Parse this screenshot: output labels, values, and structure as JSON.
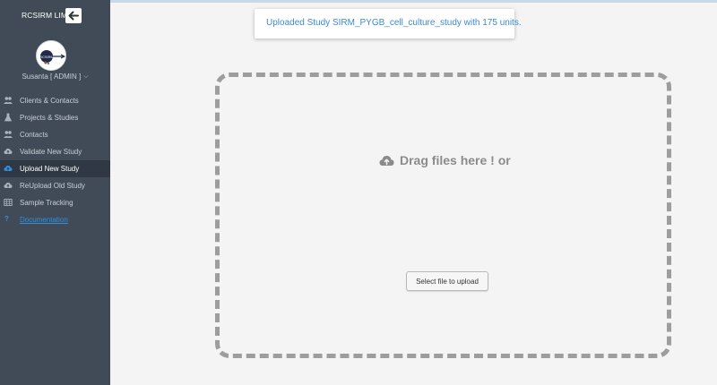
{
  "app": {
    "brand": "RCSIRM LIMS",
    "user_label": "Susanta [ ADMIN ]"
  },
  "sidebar": {
    "items": [
      {
        "label": "Clients & Contacts",
        "icon": "users-icon"
      },
      {
        "label": "Projects & Studies",
        "icon": "flask-icon"
      },
      {
        "label": "Contacts",
        "icon": "users-icon"
      },
      {
        "label": "Validate New Study",
        "icon": "cloud-upload-icon"
      },
      {
        "label": "Upload New Study",
        "icon": "cloud-upload-icon",
        "active": true
      },
      {
        "label": "ReUpload Old Study",
        "icon": "cloud-upload-icon"
      },
      {
        "label": "Sample Tracking",
        "icon": "table-icon"
      },
      {
        "label": "Documentation",
        "icon": "question-icon",
        "link": true
      }
    ]
  },
  "toast": {
    "message": "Uploaded Study SIRM_PYGB_cell_culture_study with 175 units."
  },
  "dropzone": {
    "prompt": "Drag files here ! or",
    "button_label": "Select file to upload"
  },
  "colors": {
    "sidebar_bg": "#414b57",
    "active_bg": "#2f3843",
    "link_blue": "#2f8fe0",
    "toast_text": "#3a8ad1",
    "dropzone_border": "#9d9d9d"
  }
}
